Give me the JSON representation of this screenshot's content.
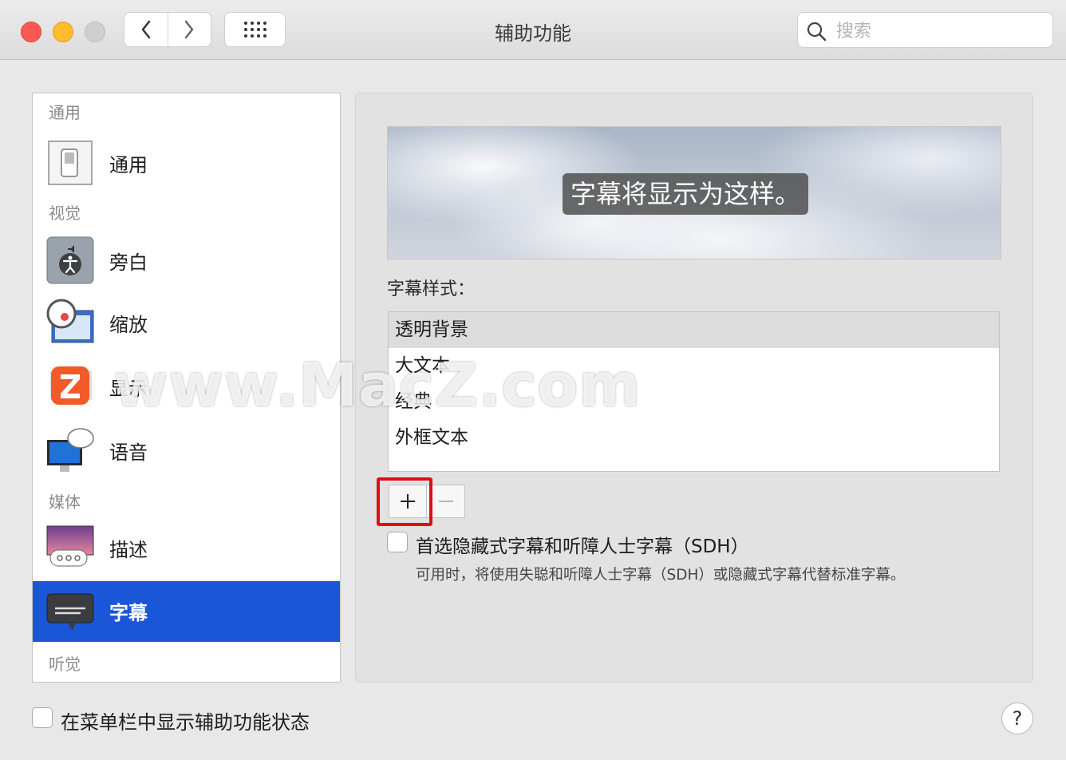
{
  "window": {
    "title": "辅助功能"
  },
  "search": {
    "placeholder": "搜索"
  },
  "sidebar": {
    "sections": [
      "通用",
      "视觉",
      "媒体",
      "听觉"
    ],
    "items": [
      {
        "label": "通用",
        "icon": "switch-icon"
      },
      {
        "label": "旁白",
        "icon": "voiceover-icon"
      },
      {
        "label": "缩放",
        "icon": "zoom-magnifier-icon"
      },
      {
        "label": "显示",
        "icon": "display-monitor-icon"
      },
      {
        "label": "语音",
        "icon": "speech-monitor-icon"
      },
      {
        "label": "描述",
        "icon": "description-icon"
      },
      {
        "label": "字幕",
        "icon": "captions-icon",
        "selected": true
      }
    ]
  },
  "preview": {
    "caption": "字幕将显示为这样。"
  },
  "styles": {
    "label": "字幕样式：",
    "items": [
      "透明背景",
      "大文本",
      "经典",
      "外框文本"
    ],
    "selected_index": 0
  },
  "sdh": {
    "label": "首选隐藏式字幕和听障人士字幕（SDH）",
    "help": "可用时，将使用失聪和听障人士字幕（SDH）或隐藏式字幕代替标准字幕。",
    "checked": false
  },
  "footer": {
    "status_label": "在菜单栏中显示辅助功能状态",
    "help": "?"
  },
  "watermark": {
    "text": "www.MacZ.com",
    "logo_letter": "Z"
  },
  "colors": {
    "selection": "#1a56d8",
    "highlight": "#e10e10"
  }
}
